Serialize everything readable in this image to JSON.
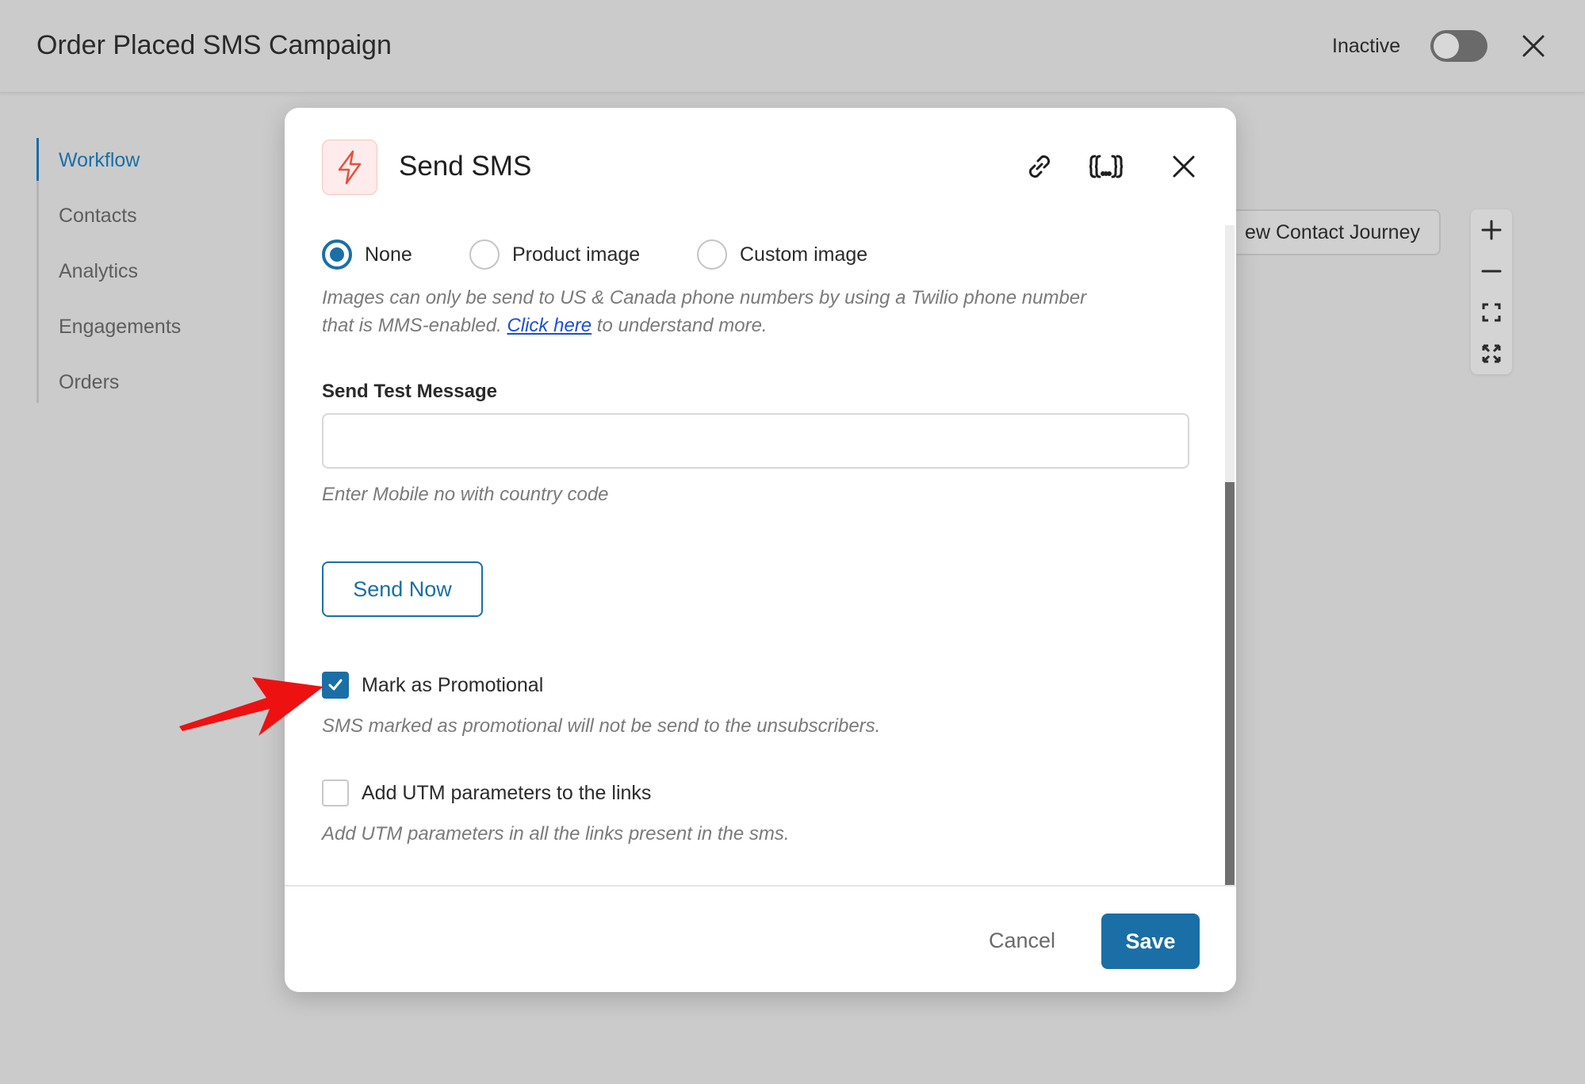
{
  "header": {
    "title": "Order Placed SMS Campaign",
    "status_label": "Inactive",
    "close_icon": "close-icon"
  },
  "side_nav": {
    "items": [
      {
        "label": "Workflow",
        "active": true
      },
      {
        "label": "Contacts",
        "active": false
      },
      {
        "label": "Analytics",
        "active": false
      },
      {
        "label": "Engagements",
        "active": false
      },
      {
        "label": "Orders",
        "active": false
      }
    ]
  },
  "canvas": {
    "journey_button_label": "ew Contact Journey",
    "zoom_controls": [
      "plus-icon",
      "minus-icon",
      "fit-screen-icon",
      "fullscreen-icon"
    ]
  },
  "modal": {
    "title": "Send SMS",
    "action_icon": "lightning-icon",
    "header_icons": [
      "link-icon",
      "merge-tags-icon",
      "close-icon"
    ],
    "image_options": [
      {
        "label": "None",
        "checked": true
      },
      {
        "label": "Product image",
        "checked": false
      },
      {
        "label": "Custom image",
        "checked": false
      }
    ],
    "image_help_line1": "Images can only be send to US & Canada phone numbers by using a Twilio phone number",
    "image_help_line2_before": "that is MMS-enabled. ",
    "image_help_link": "Click here",
    "image_help_line2_after": " to understand more.",
    "test_message_label": "Send Test Message",
    "test_message_value": "",
    "test_message_help": "Enter Mobile no with country code",
    "send_now_label": "Send Now",
    "promotional_label": "Mark as Promotional",
    "promotional_checked": true,
    "promotional_help": "SMS marked as promotional will not be send to the unsubscribers.",
    "utm_label": "Add UTM parameters to the links",
    "utm_checked": false,
    "utm_help": "Add UTM parameters in all the links present in the sms.",
    "cancel_label": "Cancel",
    "save_label": "Save"
  },
  "colors": {
    "accent": "#1a6fa6",
    "backdrop": "#cbcbcb",
    "annotation_arrow": "#ee1111",
    "action_icon": "#e4513e"
  }
}
